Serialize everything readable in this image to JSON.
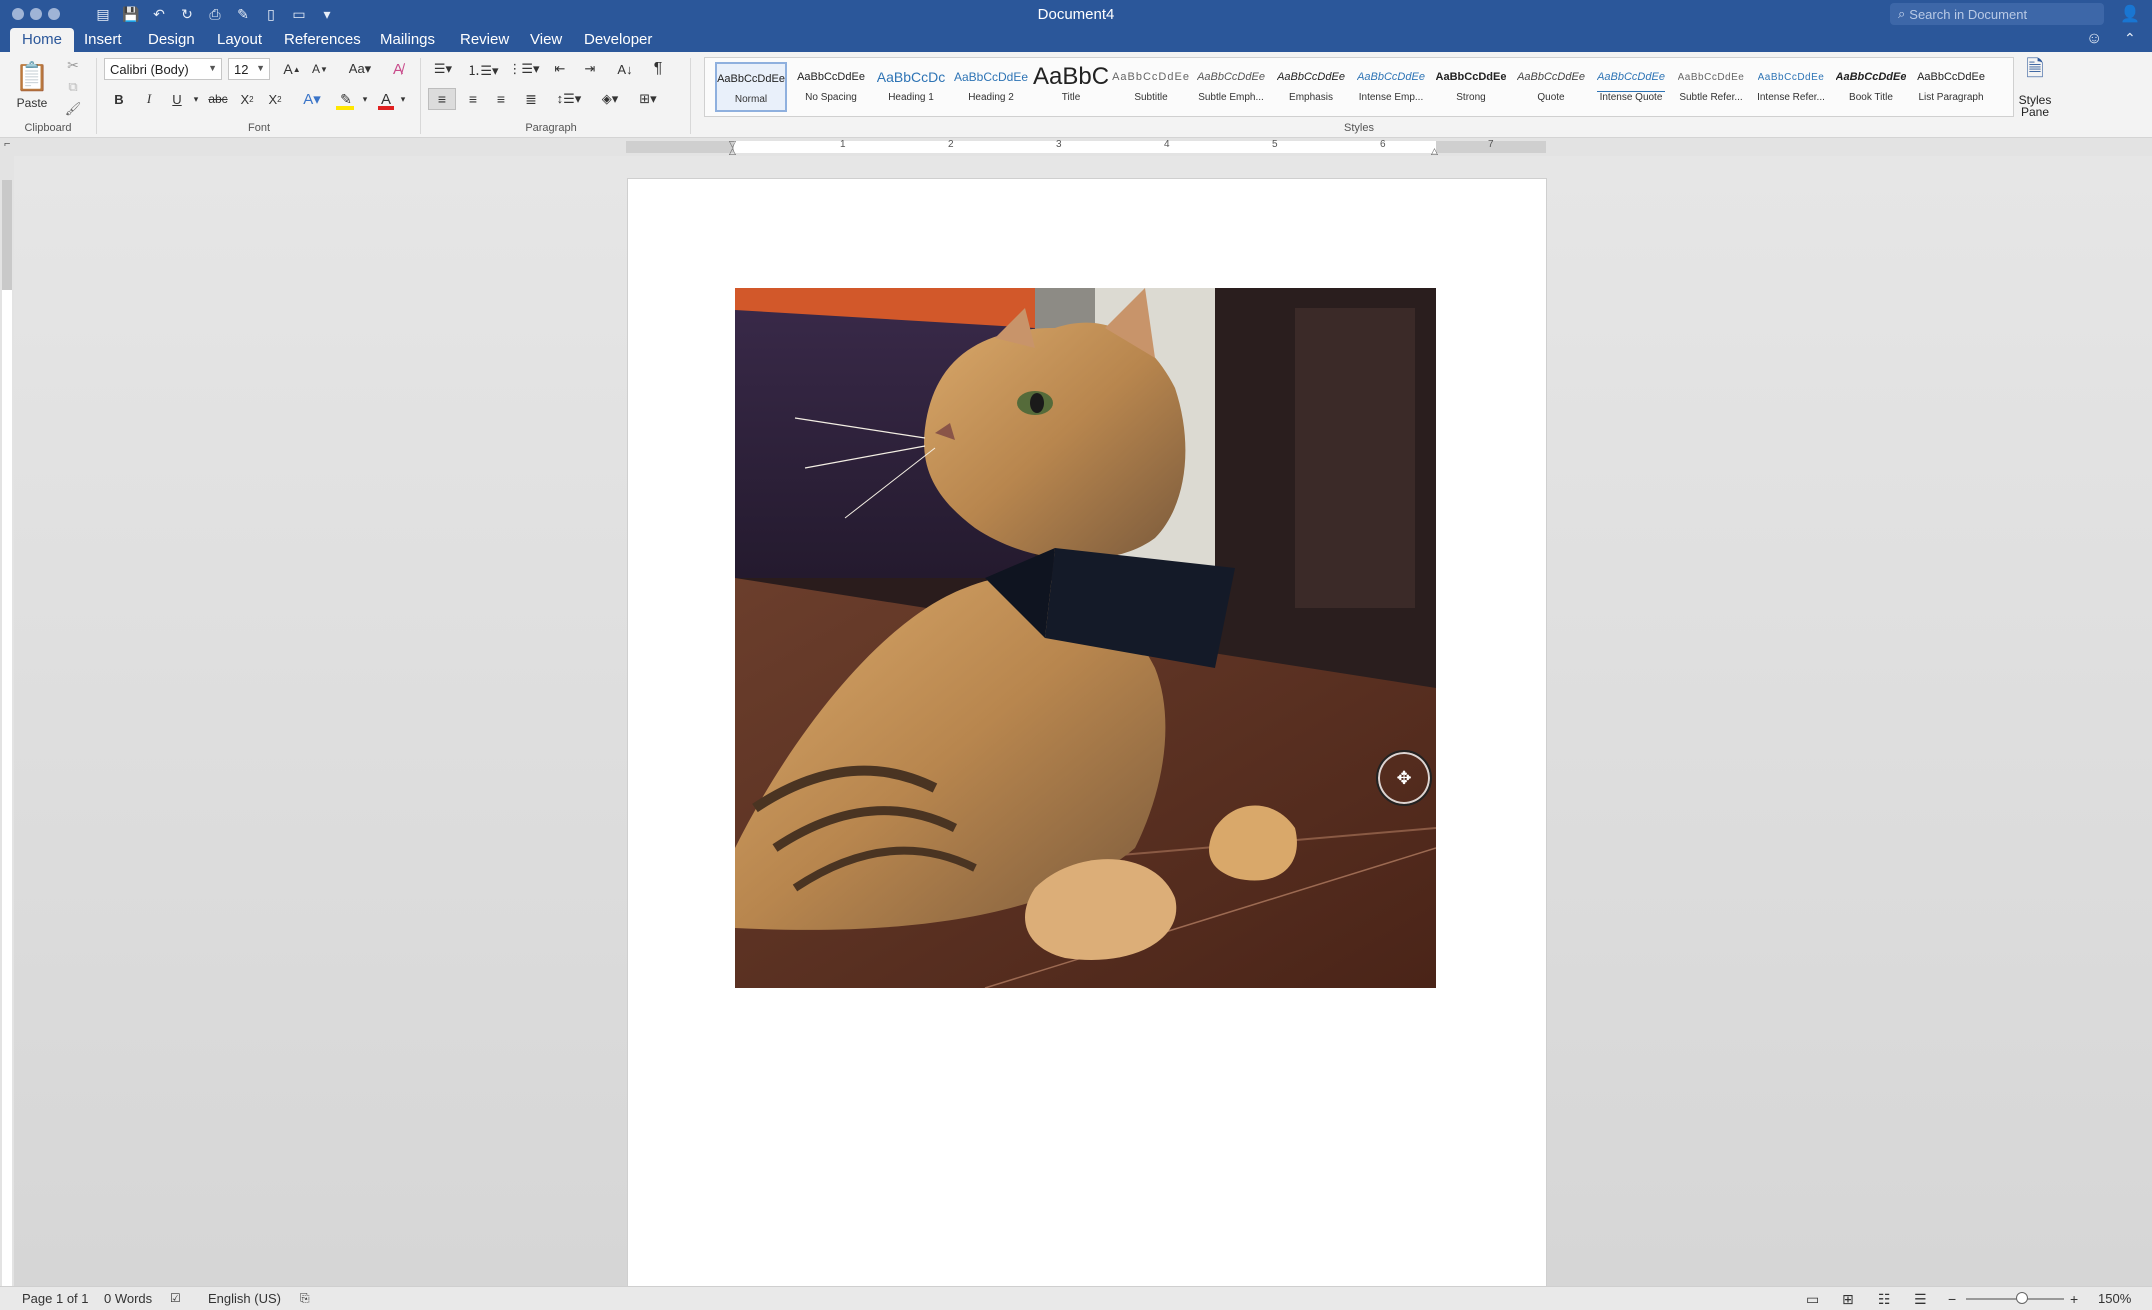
{
  "window": {
    "title": "Document4",
    "search_placeholder": "Search in Document"
  },
  "tabs": [
    "Home",
    "Insert",
    "Design",
    "Layout",
    "References",
    "Mailings",
    "Review",
    "View",
    "Developer"
  ],
  "ribbon": {
    "clipboard": {
      "paste_label": "Paste",
      "group_label": "Clipboard"
    },
    "font": {
      "font_name": "Calibri (Body)",
      "font_size": "12",
      "group_label": "Font"
    },
    "paragraph": {
      "group_label": "Paragraph"
    },
    "styles": {
      "group_label": "Styles",
      "pane_label_1": "Styles",
      "pane_label_2": "Pane",
      "items": [
        {
          "sample": "AaBbCcDdEe",
          "name": "Normal"
        },
        {
          "sample": "AaBbCcDdEe",
          "name": "No Spacing"
        },
        {
          "sample": "AaBbCcDc",
          "name": "Heading 1"
        },
        {
          "sample": "AaBbCcDdEe",
          "name": "Heading 2"
        },
        {
          "sample": "AaBbC",
          "name": "Title"
        },
        {
          "sample": "AaBbCcDdEe",
          "name": "Subtitle"
        },
        {
          "sample": "AaBbCcDdEe",
          "name": "Subtle Emph..."
        },
        {
          "sample": "AaBbCcDdEe",
          "name": "Emphasis"
        },
        {
          "sample": "AaBbCcDdEe",
          "name": "Intense Emp..."
        },
        {
          "sample": "AaBbCcDdEe",
          "name": "Strong"
        },
        {
          "sample": "AaBbCcDdEe",
          "name": "Quote"
        },
        {
          "sample": "AaBbCcDdEe",
          "name": "Intense Quote"
        },
        {
          "sample": "AaBbCcDdEe",
          "name": "Subtle Refer..."
        },
        {
          "sample": "AaBbCcDdEe",
          "name": "Intense Refer..."
        },
        {
          "sample": "AaBbCcDdEe",
          "name": "Book Title"
        },
        {
          "sample": "AaBbCcDdEe",
          "name": "List Paragraph"
        }
      ]
    }
  },
  "ruler_numbers": [
    "1",
    "2",
    "3",
    "4",
    "5",
    "6",
    "7"
  ],
  "statusbar": {
    "page": "Page 1 of 1",
    "words": "0 Words",
    "language": "English (US)",
    "zoom": "150%"
  },
  "colors": {
    "accent": "#2b579a",
    "font_color_bar": "#e02020",
    "highlight_bar": "#ffe600"
  }
}
